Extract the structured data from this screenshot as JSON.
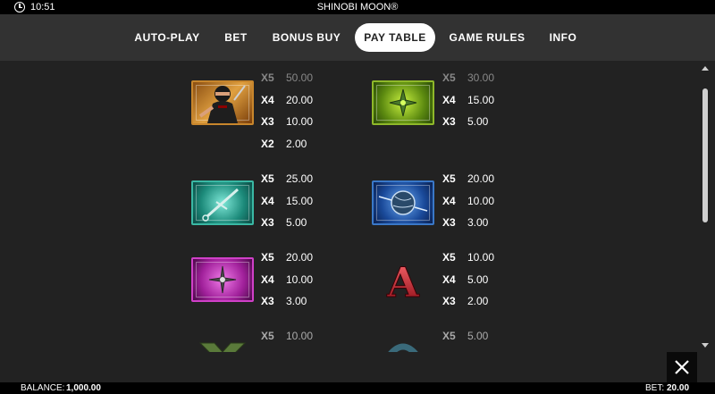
{
  "status_bar": {
    "time": "10:51",
    "title": "SHINOBI MOON®"
  },
  "nav": {
    "tabs": [
      {
        "label": "AUTO-PLAY",
        "active": false
      },
      {
        "label": "BET",
        "active": false
      },
      {
        "label": "BONUS BUY",
        "active": false
      },
      {
        "label": "PAY TABLE",
        "active": true
      },
      {
        "label": "GAME RULES",
        "active": false
      },
      {
        "label": "INFO",
        "active": false
      }
    ]
  },
  "paytable": [
    {
      "symbol": "ninja",
      "pays": [
        {
          "mult": "X5",
          "value": "50.00"
        },
        {
          "mult": "X4",
          "value": "20.00"
        },
        {
          "mult": "X3",
          "value": "10.00"
        },
        {
          "mult": "X2",
          "value": "2.00"
        }
      ]
    },
    {
      "symbol": "green-shuriken",
      "pays": [
        {
          "mult": "X5",
          "value": "30.00"
        },
        {
          "mult": "X4",
          "value": "15.00"
        },
        {
          "mult": "X3",
          "value": "5.00"
        }
      ]
    },
    {
      "symbol": "teal-kunai",
      "pays": [
        {
          "mult": "X5",
          "value": "25.00"
        },
        {
          "mult": "X4",
          "value": "15.00"
        },
        {
          "mult": "X3",
          "value": "5.00"
        }
      ]
    },
    {
      "symbol": "blue-orb",
      "pays": [
        {
          "mult": "X5",
          "value": "20.00"
        },
        {
          "mult": "X4",
          "value": "10.00"
        },
        {
          "mult": "X3",
          "value": "3.00"
        }
      ]
    },
    {
      "symbol": "purple-shuriken",
      "pays": [
        {
          "mult": "X5",
          "value": "20.00"
        },
        {
          "mult": "X4",
          "value": "10.00"
        },
        {
          "mult": "X3",
          "value": "3.00"
        }
      ]
    },
    {
      "symbol": "letter-a",
      "letter": "A",
      "pays": [
        {
          "mult": "X5",
          "value": "10.00"
        },
        {
          "mult": "X4",
          "value": "5.00"
        },
        {
          "mult": "X3",
          "value": "2.00"
        }
      ]
    },
    {
      "symbol": "letter-k",
      "pays": [
        {
          "mult": "X5",
          "value": "10.00"
        }
      ]
    },
    {
      "symbol": "letter-q",
      "pays": [
        {
          "mult": "X5",
          "value": "5.00"
        }
      ]
    }
  ],
  "footer": {
    "balance_label": "BALANCE:",
    "balance_value": "1,000.00",
    "bet_label": "BET:",
    "bet_value": "20.00"
  },
  "icons": {
    "clock": "clock-icon",
    "close": "close-icon"
  },
  "colors": {
    "background": "#222222",
    "nav_bg": "#323232",
    "active_tab_bg": "#ffffff",
    "bars": "#000000"
  }
}
